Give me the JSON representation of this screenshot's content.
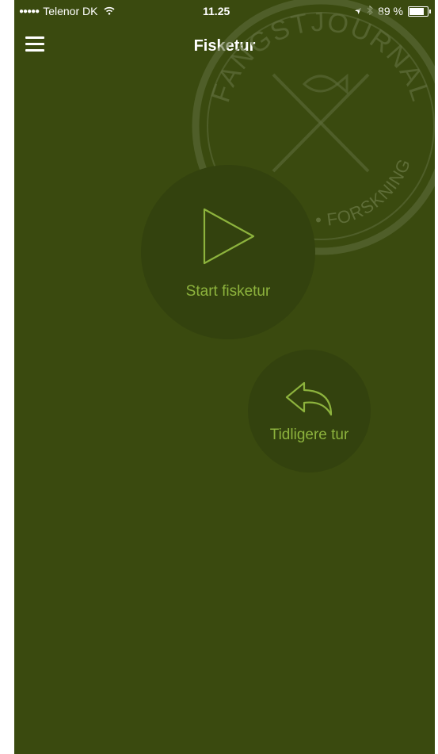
{
  "status_bar": {
    "signal": "●●●●●",
    "carrier": "Telenor DK",
    "wifi_icon": "wifi-icon",
    "time": "11.25",
    "location_icon": "location-arrow-icon",
    "bluetooth_icon": "bluetooth-icon",
    "battery": "89 %",
    "battery_level": 0.89
  },
  "header": {
    "title": "Fisketur",
    "menu_icon": "hamburger-menu-icon"
  },
  "watermark": {
    "top_text": "FANGSTJOURNAL",
    "bottom_text": "PRAL • FORSKNING",
    "icon": "fishing-logo-icon"
  },
  "actions": {
    "start": {
      "label": "Start fisketur",
      "icon": "play-icon"
    },
    "previous": {
      "label": "Tidligere tur",
      "icon": "reply-arrow-icon"
    }
  },
  "colors": {
    "background": "#3a4a0f",
    "circle": "#33420e",
    "accent": "#8db33d",
    "text": "#ffffff"
  }
}
